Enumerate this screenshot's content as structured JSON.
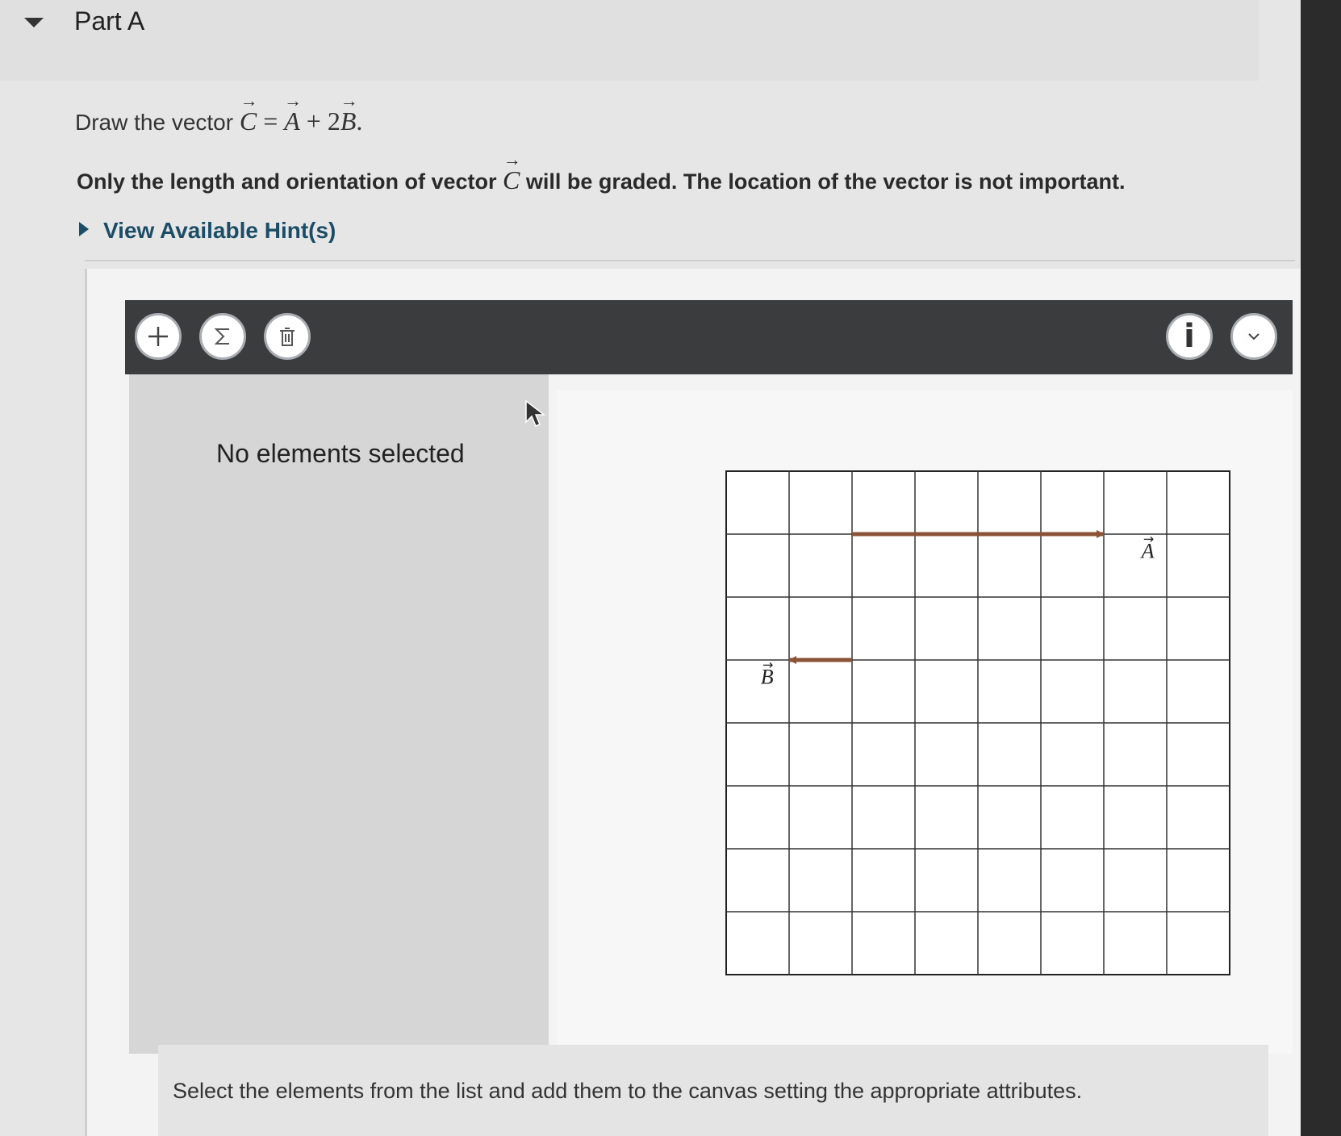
{
  "part": {
    "title": "Part A"
  },
  "question": {
    "prefix": "Draw the vector ",
    "c": "C",
    "equals": " = ",
    "a": "A",
    "plus": " + ",
    "two": "2",
    "b": "B",
    "period": "."
  },
  "instruction": {
    "before": "Only the length and orientation of vector ",
    "c": "C",
    "after": " will be graded. The location of the vector is not important."
  },
  "hints": {
    "label": "View Available Hint(s)"
  },
  "toolbar": {
    "add_icon": "plus-icon",
    "sum_icon": "sigma-icon",
    "delete_icon": "trash-icon",
    "info_icon": "info-icon",
    "menu_icon": "chevron-down-icon",
    "info_label": "i"
  },
  "panel": {
    "no_selection": "No elements selected"
  },
  "grid": {
    "columns": 8,
    "rows": 8,
    "vectors": [
      {
        "name": "A",
        "label": "A",
        "start": [
          2,
          1
        ],
        "end": [
          6,
          1
        ],
        "color": "#8a5236"
      },
      {
        "name": "B",
        "label": "B",
        "start": [
          2,
          3
        ],
        "end": [
          1,
          3
        ],
        "color": "#8a5236"
      }
    ]
  },
  "footer": {
    "text": "Select the elements from the list and add them to the canvas setting the appropriate attributes."
  }
}
